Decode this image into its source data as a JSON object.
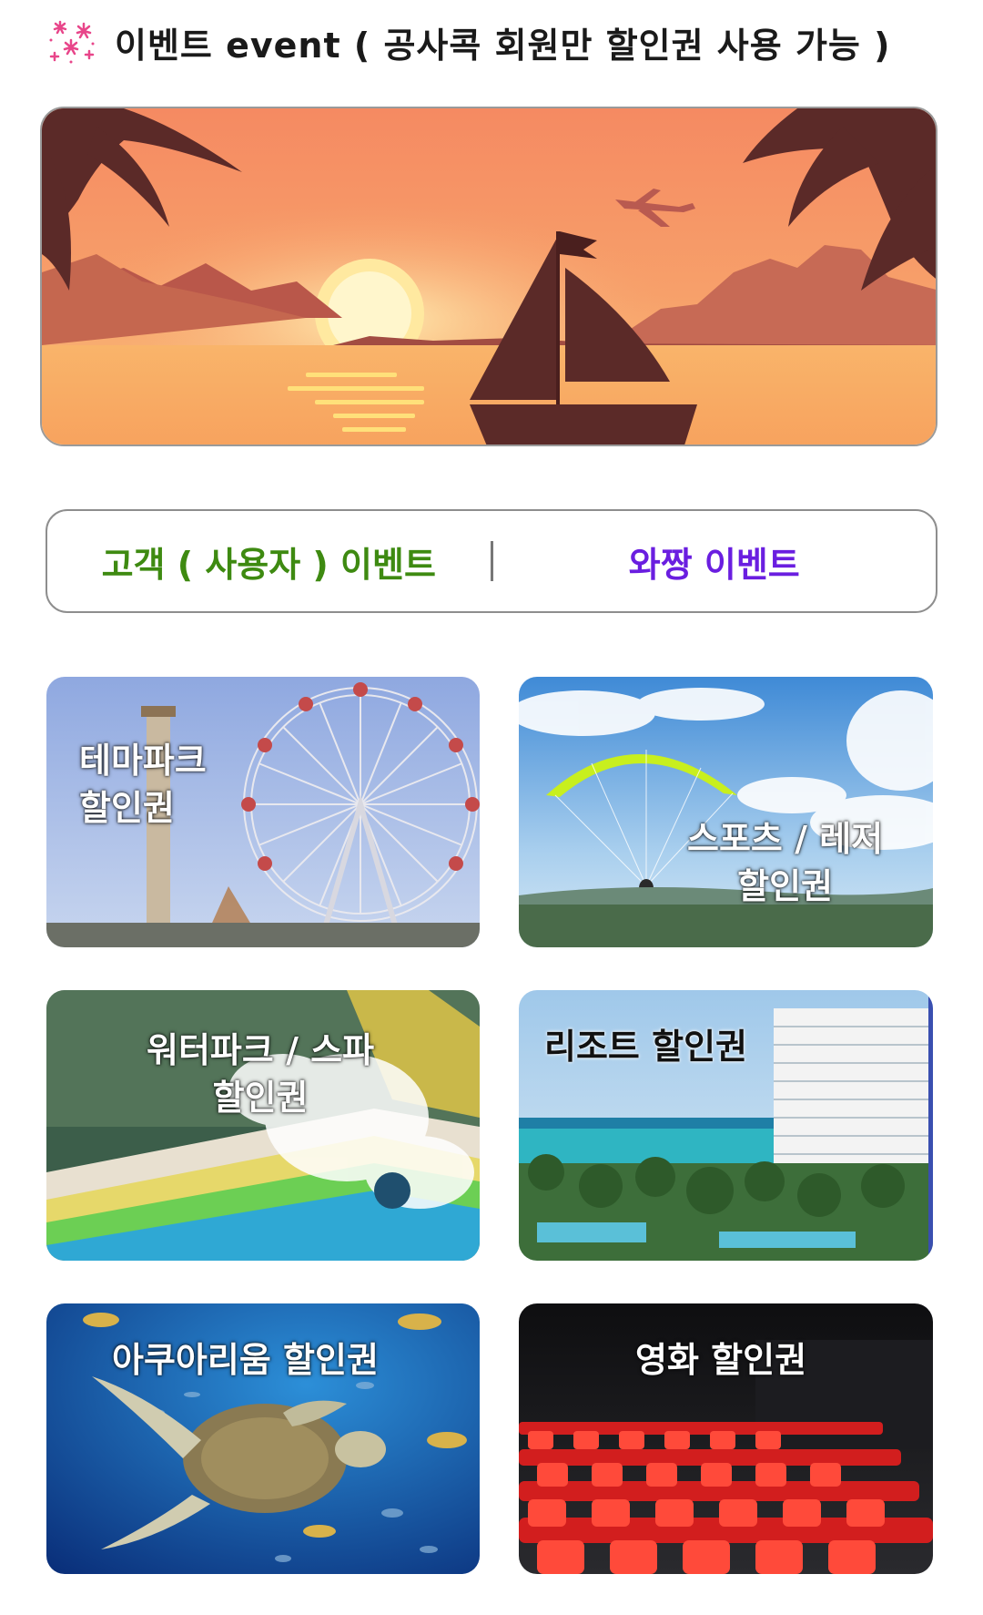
{
  "header": {
    "icon": "fireworks-icon",
    "title": "이벤트 event ( 공사콕 회원만 할인권 사용 가능 )"
  },
  "banner": {
    "icon": "sunset-sailboat-illustration"
  },
  "tabs": [
    {
      "label": "고객 ( 사용자 ) 이벤트",
      "color": "#3e8a11"
    },
    {
      "label": "와짱 이벤트",
      "color": "#6a1ee0"
    }
  ],
  "cards": [
    {
      "line1": "테마파크",
      "line2": "할인권",
      "image": "ferris-wheel-photo"
    },
    {
      "line1": "스포츠 / 레저",
      "line2": "할인권",
      "image": "paragliding-photo"
    },
    {
      "line1": "워터파크 / 스파",
      "line2": "할인권",
      "image": "waterslide-photo"
    },
    {
      "line1": "리조트 할인권",
      "line2": "",
      "image": "resort-hotel-photo"
    },
    {
      "line1": "아쿠아리움 할인권",
      "line2": "",
      "image": "sea-turtle-photo"
    },
    {
      "line1": "영화 할인권",
      "line2": "",
      "image": "cinema-seats-photo"
    }
  ]
}
